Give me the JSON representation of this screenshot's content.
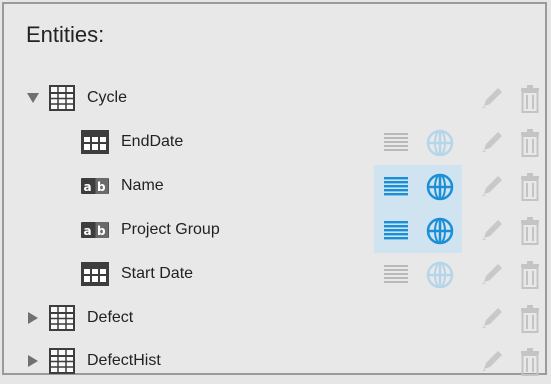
{
  "panel": {
    "title": "Entities:"
  },
  "entities": [
    {
      "label": "Cycle",
      "kind": "table",
      "state": "expanded",
      "level": 0
    },
    {
      "label": "EndDate",
      "kind": "date-field",
      "level": 1,
      "list_toggle": "off",
      "globe_toggle": "off"
    },
    {
      "label": "Name",
      "kind": "text-field",
      "level": 1,
      "list_toggle": "on",
      "globe_toggle": "on"
    },
    {
      "label": "Project Group",
      "kind": "text-field",
      "level": 1,
      "list_toggle": "on",
      "globe_toggle": "on"
    },
    {
      "label": "Start Date",
      "kind": "date-field",
      "level": 1,
      "list_toggle": "off",
      "globe_toggle": "off"
    },
    {
      "label": "Defect",
      "kind": "table",
      "state": "collapsed",
      "level": 0
    },
    {
      "label": "DefectHist",
      "kind": "table",
      "state": "collapsed",
      "level": 0
    }
  ],
  "icons": {
    "expanded": "triangle-down-icon",
    "collapsed": "triangle-right-icon",
    "table": "table-grid-icon",
    "text_field": "text-field-ab-icon",
    "date_field": "calendar-field-icon",
    "edit": "pencil-icon",
    "delete": "trash-icon",
    "list_toggle": "list-lines-icon",
    "globe_toggle": "globe-icon"
  },
  "colors": {
    "accent": "#1a8fd6",
    "active_bg": "#cfe3f1",
    "inactive_icon": "#b9b9b9",
    "disabled_action": "#c4c4c4"
  }
}
